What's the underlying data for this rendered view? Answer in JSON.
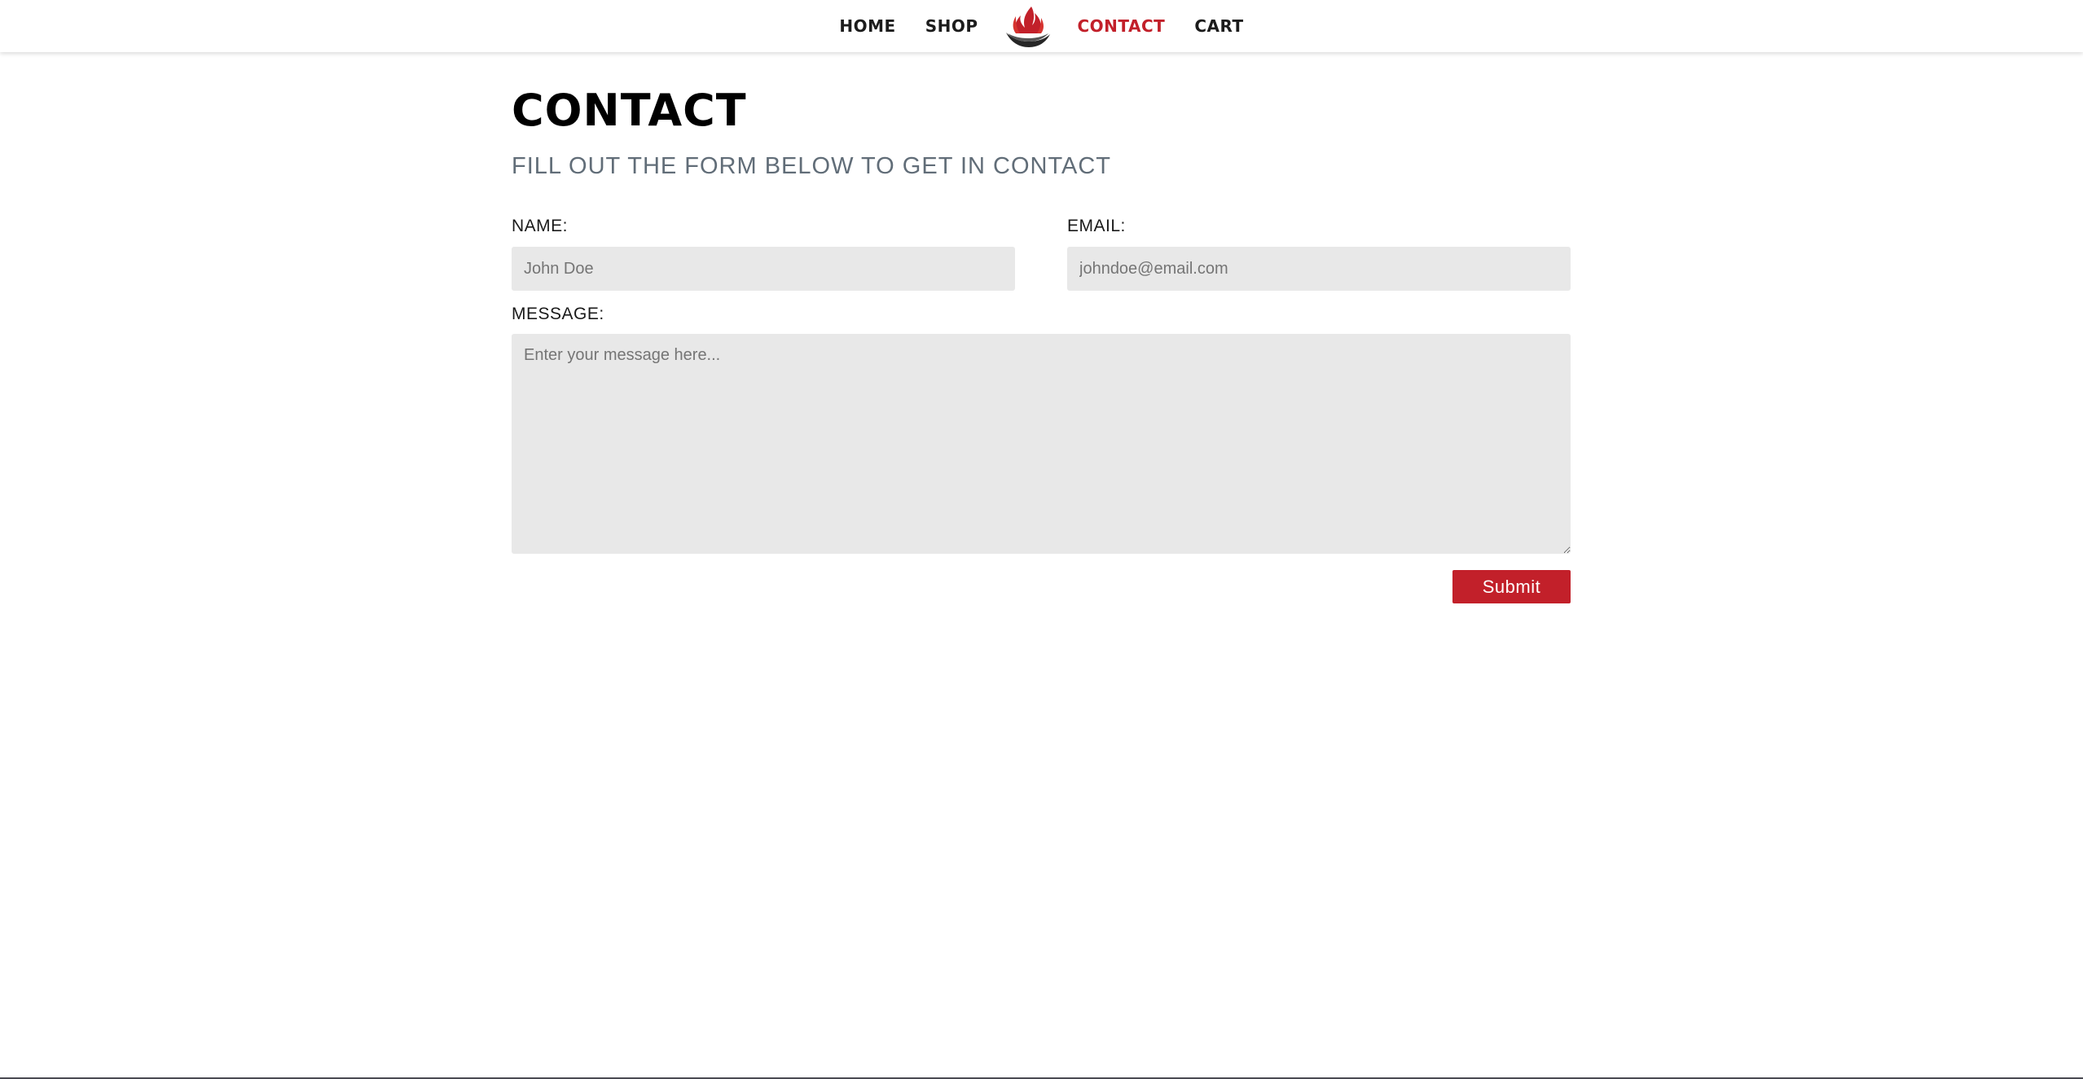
{
  "nav": {
    "home": "HOME",
    "shop": "SHOP",
    "contact": "CONTACT",
    "cart": "CART",
    "logo_icon": "flame-bowl-logo-icon",
    "active_color": "#c2202a"
  },
  "page": {
    "title": "CONTACT",
    "subtitle": "FILL OUT THE FORM BELOW TO GET IN CONTACT"
  },
  "form": {
    "name_label": "NAME:",
    "name_placeholder": "John Doe",
    "email_label": "EMAIL:",
    "email_placeholder": "johndoe@email.com",
    "message_label": "MESSAGE:",
    "message_placeholder": "Enter your message here...",
    "submit_label": "Submit"
  },
  "colors": {
    "accent": "#c2202a",
    "field_background": "#e8e8e8",
    "subtitle": "#616d78"
  }
}
